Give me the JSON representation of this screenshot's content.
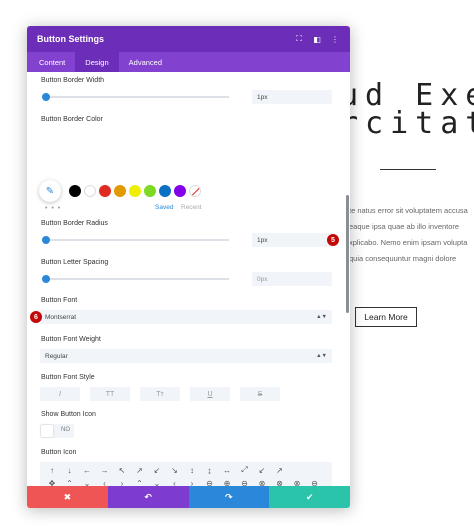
{
  "background": {
    "title_line1": "ud Exe",
    "title_line2": "rcitat",
    "paragraph_lines": [
      "te natus error sit voluptatem accusa",
      "eaque ipsa quae ab illo inventore",
      "xplicabo. Nemo enim ipsam volupta",
      "quia consequuntur magni dolore"
    ],
    "button_label": "Learn More"
  },
  "modal": {
    "title": "Button Settings",
    "tabs": [
      {
        "label": "Content"
      },
      {
        "label": "Design"
      },
      {
        "label": "Advanced"
      }
    ],
    "active_tab": "Design",
    "header_icons": [
      "expand-icon",
      "split-view-icon",
      "more-vertical-icon"
    ],
    "border_width": {
      "label": "Button Border Width",
      "value": "1px",
      "slider_fraction": 0.0
    },
    "border_color": {
      "label": "Button Border Color",
      "swatches": [
        "#000000",
        "#ffffff",
        "#e02b20",
        "#e09900",
        "#edf000",
        "#7cda24",
        "#0c71c3",
        "#8300e9"
      ],
      "saved_label": "Saved",
      "recent_label": "Recent",
      "more": "• • •"
    },
    "border_radius": {
      "label": "Button Border Radius",
      "value": "1px",
      "slider_fraction": 0.0,
      "badge": "5"
    },
    "letter_spacing": {
      "label": "Button Letter Spacing",
      "value": "0px",
      "slider_fraction": 0.0
    },
    "font": {
      "label": "Button Font",
      "value": "Montserrat",
      "badge": "6"
    },
    "font_weight": {
      "label": "Button Font Weight",
      "value": "Regular"
    },
    "font_style": {
      "label": "Button Font Style",
      "options": [
        "I",
        "TT",
        "Tт",
        "U",
        "S"
      ]
    },
    "show_icon": {
      "label": "Show Button Icon",
      "value": "NO"
    },
    "button_icon": {
      "label": "Button Icon",
      "rows": [
        [
          "↑",
          "↓",
          "←",
          "→",
          "↖",
          "↗",
          "↙",
          "↘",
          "↕",
          "↨",
          "↔",
          "⤢",
          "↙",
          "↗"
        ],
        [
          "✥",
          "⌃",
          "⌄",
          "‹",
          "›",
          "⌃",
          "⌄",
          "‹",
          "›",
          "⊖",
          "⊕",
          "⊖",
          "⊗",
          "⊗",
          "⊗",
          "⊖"
        ],
        [
          "⊙",
          "⊘",
          "⊙",
          "⊙",
          "◷",
          "⊙",
          "◉",
          "⊙",
          "☐",
          "⊞",
          "○",
          "⊙",
          "◉",
          "⊙",
          "⊙",
          "⊙"
        ]
      ]
    },
    "footer": {
      "cancel": "✖",
      "undo": "↶",
      "redo": "↷",
      "save": "✔",
      "colors": {
        "cancel": "#ef5555",
        "undo": "#7e3bd0",
        "redo": "#2b87da",
        "save": "#29c4a9"
      }
    }
  }
}
